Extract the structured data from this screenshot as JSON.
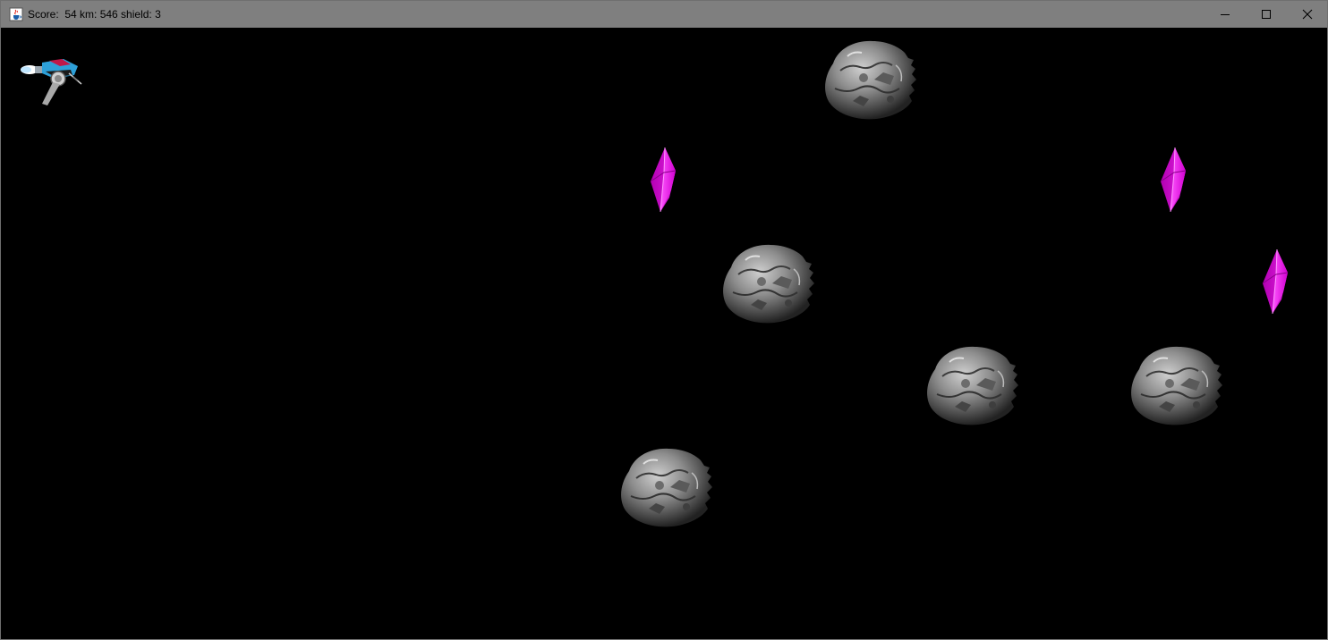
{
  "window": {
    "title": "Score:  54 km: 546 shield: 3",
    "app_icon": "java-cup-icon",
    "controls": {
      "minimize_icon": "minimize-icon",
      "maximize_icon": "maximize-icon",
      "close_icon": "close-icon"
    }
  },
  "game": {
    "score": 54,
    "km": 546,
    "shield": 3,
    "player": {
      "icon": "spaceship-icon"
    },
    "asteroid_count": 5,
    "crystal_count": 3
  },
  "colors": {
    "titlebar": "#7f7f7f",
    "background": "#000000",
    "crystal": "#ee22ee",
    "asteroid": "#8a8a8a"
  }
}
